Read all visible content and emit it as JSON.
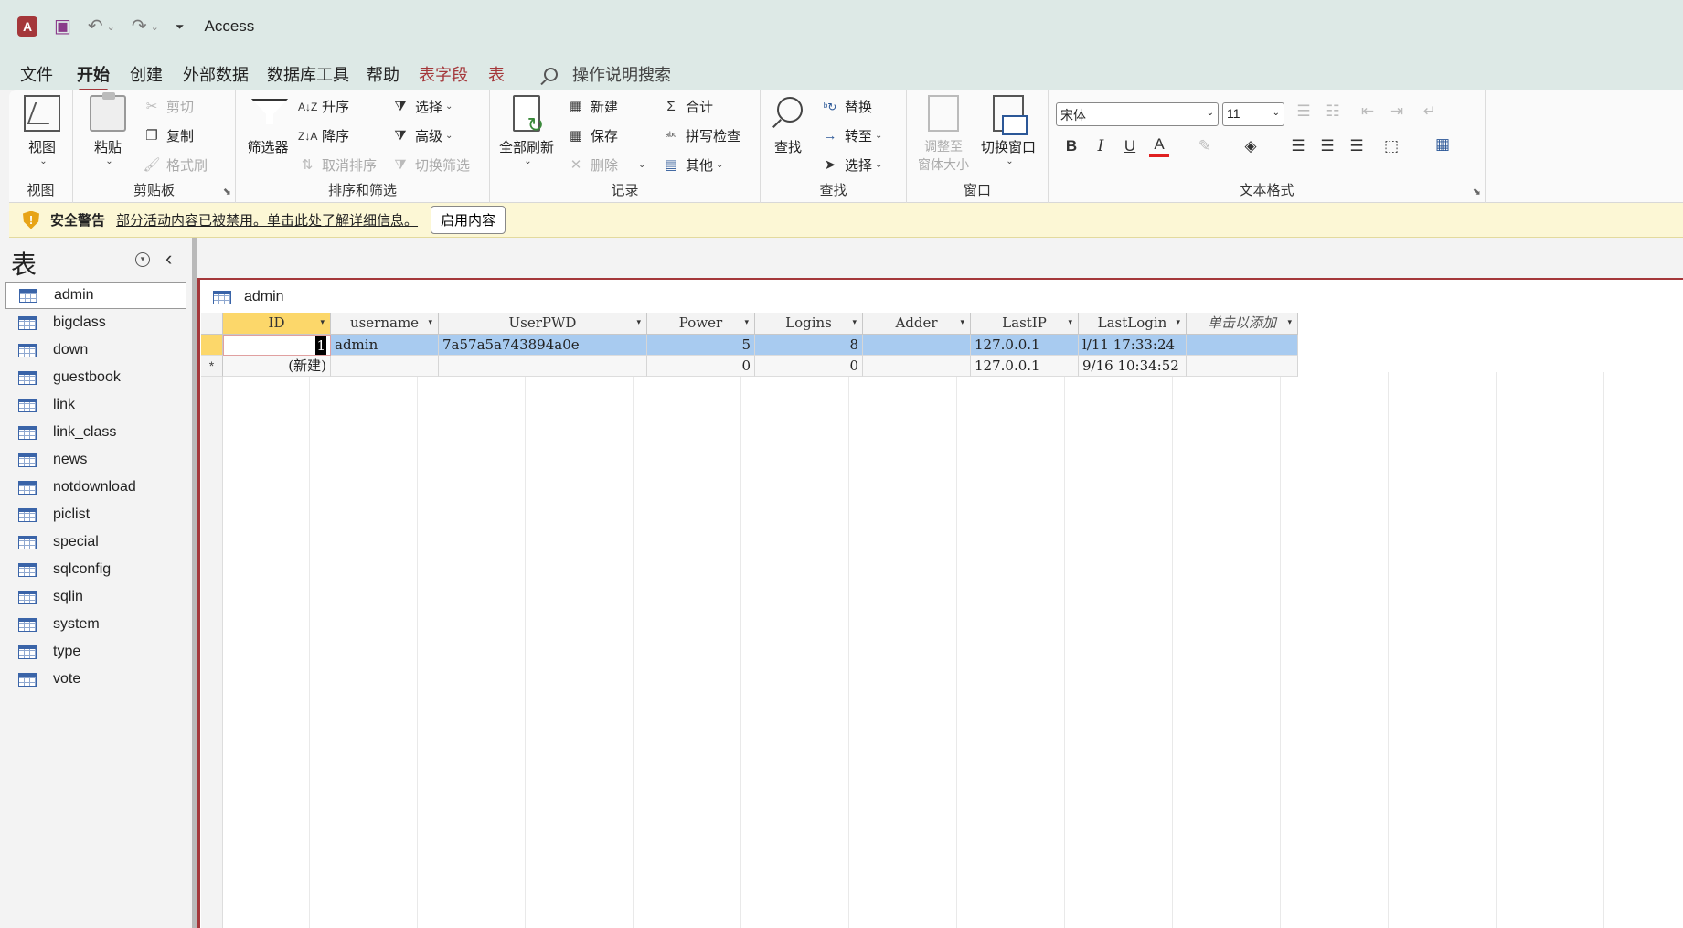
{
  "titlebar": {
    "app_title": "Access",
    "logo_letter": "A"
  },
  "menu": {
    "tabs": [
      "文件",
      "开始",
      "创建",
      "外部数据",
      "数据库工具",
      "帮助",
      "表字段",
      "表"
    ],
    "tell_me": "操作说明搜索"
  },
  "ribbon": {
    "view": {
      "label": "视图",
      "group": "视图"
    },
    "clipboard": {
      "paste": "粘贴",
      "cut": "剪切",
      "copy": "复制",
      "format_painter": "格式刷",
      "group": "剪贴板"
    },
    "sort_filter": {
      "filter": "筛选器",
      "ascending": "升序",
      "descending": "降序",
      "remove_sort": "取消排序",
      "selection": "选择",
      "advanced": "高级",
      "toggle_filter": "切换筛选",
      "group": "排序和筛选"
    },
    "records": {
      "refresh_all": "全部刷新",
      "new": "新建",
      "save": "保存",
      "delete": "删除",
      "totals": "合计",
      "spelling": "拼写检查",
      "more": "其他",
      "group": "记录"
    },
    "find": {
      "find": "查找",
      "replace": "替换",
      "goto": "转至",
      "select": "选择",
      "group": "查找"
    },
    "window": {
      "fit": "调整至窗体大小",
      "fit_line1": "调整至",
      "fit_line2": "窗体大小",
      "switch": "切换窗口",
      "group": "窗口"
    },
    "text_format": {
      "font": "宋体",
      "size": "11",
      "bold": "B",
      "italic": "I",
      "underline": "U",
      "font_color_glyph": "A",
      "group": "文本格式"
    }
  },
  "security_bar": {
    "title": "安全警告",
    "message": "部分活动内容已被禁用。单击此处了解详细信息。",
    "button": "启用内容"
  },
  "nav_pane": {
    "header": "表",
    "items": [
      "admin",
      "bigclass",
      "down",
      "guestbook",
      "link",
      "link_class",
      "news",
      "notdownload",
      "piclist",
      "special",
      "sqlconfig",
      "sqlin",
      "system",
      "type",
      "vote"
    ],
    "selected": "admin"
  },
  "document": {
    "tab_label": "admin",
    "columns": [
      "ID",
      "username",
      "UserPWD",
      "Power",
      "Logins",
      "Adder",
      "LastIP",
      "LastLogin",
      "单击以添加"
    ],
    "rows": [
      {
        "ID": "1",
        "username": "admin",
        "UserPWD": "7a57a5a743894a0e",
        "Power": "5",
        "Logins": "8",
        "Adder": "",
        "LastIP": "127.0.0.1",
        "LastLogin": "l/11 17:33:24"
      },
      {
        "ID": "(新建)",
        "username": "",
        "UserPWD": "",
        "Power": "0",
        "Logins": "0",
        "Adder": "",
        "LastIP": "127.0.0.1",
        "LastLogin": "9/16 10:34:52"
      }
    ],
    "new_row_marker": "*"
  },
  "colors": {
    "accent": "#a4373a",
    "selection": "#a8cbf0",
    "header_selected": "#fcd76a",
    "warning_bg": "#fcf7d5"
  }
}
